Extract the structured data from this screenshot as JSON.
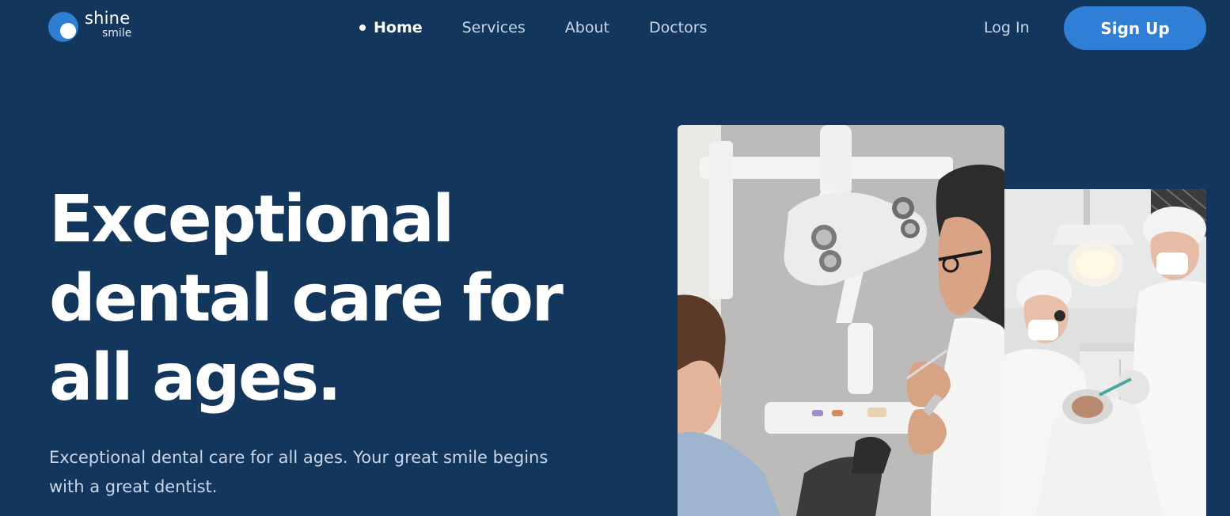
{
  "brand": {
    "name_top": "shine",
    "name_bottom": "smile",
    "accent": "#2f7fd6",
    "background": "#13365c"
  },
  "nav": {
    "items": [
      {
        "label": "Home",
        "active": true
      },
      {
        "label": "Services",
        "active": false
      },
      {
        "label": "About",
        "active": false
      },
      {
        "label": "Doctors",
        "active": false
      }
    ]
  },
  "auth": {
    "login_label": "Log In",
    "signup_label": "Sign Up"
  },
  "hero": {
    "title": "Exceptional dental care for all ages.",
    "subtitle": "Exceptional dental care for all ages. Your great smile begins with a great dentist."
  },
  "images": {
    "main_icon": "dentist-with-patient-photo",
    "side_icon": "dental-procedure-photo"
  }
}
